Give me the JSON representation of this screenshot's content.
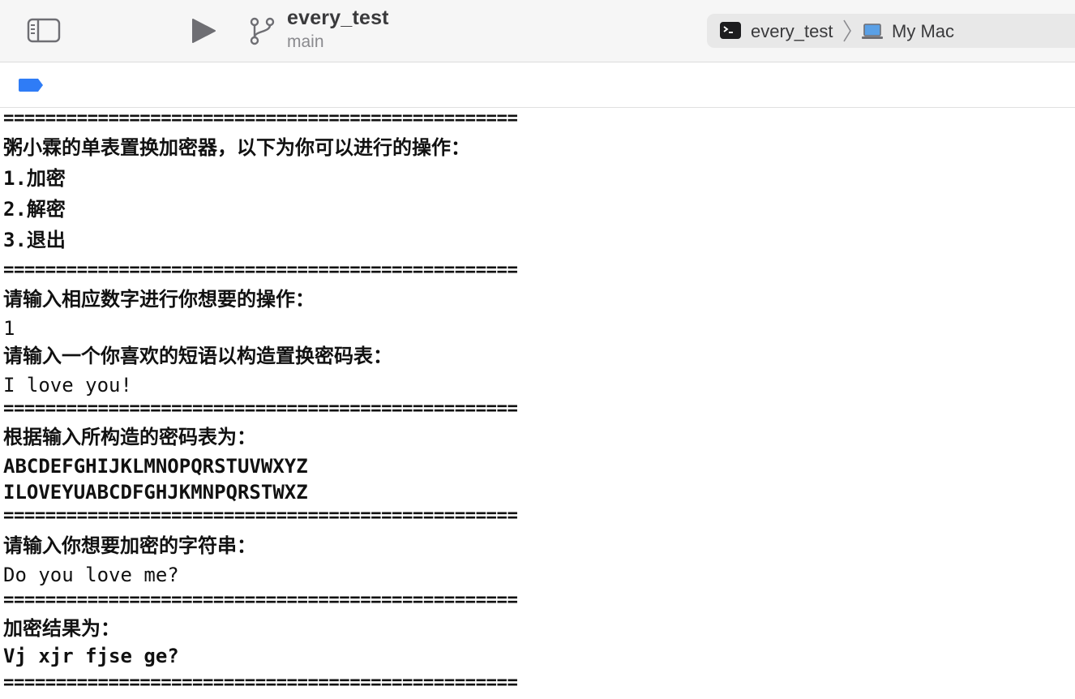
{
  "toolbar": {
    "project_name": "every_test",
    "branch": "main",
    "scheme_target": "every_test",
    "scheme_destination": "My Mac"
  },
  "icons": {
    "sidebar_toggle": "sidebar-left-icon",
    "run": "play-icon",
    "branch": "git-branch-icon",
    "terminal": "terminal-icon",
    "breadcrumb_separator": "chevron-right-icon",
    "laptop": "laptop-icon",
    "filter_tag": "tag-icon"
  },
  "colors": {
    "accent": "#2f7cf6",
    "toolbar_bg": "#f6f6f6",
    "console_text": "#111111"
  },
  "console": {
    "lines": [
      {
        "text": "=================================================",
        "style": "sep"
      },
      {
        "text": "粥小霖的单表置换加密器，以下为你可以进行的操作：",
        "style": "b"
      },
      {
        "text": "1.加密",
        "style": "b"
      },
      {
        "text": "2.解密",
        "style": "b"
      },
      {
        "text": "3.退出",
        "style": "b"
      },
      {
        "text": "=================================================",
        "style": "sep"
      },
      {
        "text": "请输入相应数字进行你想要的操作：",
        "style": "b"
      },
      {
        "text": "1",
        "style": "n"
      },
      {
        "text": "请输入一个你喜欢的短语以构造置换密码表：",
        "style": "b"
      },
      {
        "text": "I love you!",
        "style": "n"
      },
      {
        "text": "=================================================",
        "style": "sep"
      },
      {
        "text": "根据输入所构造的密码表为：",
        "style": "b"
      },
      {
        "text": "ABCDEFGHIJKLMNOPQRSTUVWXYZ",
        "style": "b"
      },
      {
        "text": "ILOVEYUABCDFGHJKMNPQRSTWXZ",
        "style": "b"
      },
      {
        "text": "=================================================",
        "style": "sep"
      },
      {
        "text": "请输入你想要加密的字符串：",
        "style": "b"
      },
      {
        "text": "Do you love me?",
        "style": "n"
      },
      {
        "text": "=================================================",
        "style": "sep"
      },
      {
        "text": "加密结果为：",
        "style": "b"
      },
      {
        "text": "Vj xjr fjse ge?",
        "style": "b"
      },
      {
        "text": "=================================================",
        "style": "sep"
      }
    ]
  }
}
